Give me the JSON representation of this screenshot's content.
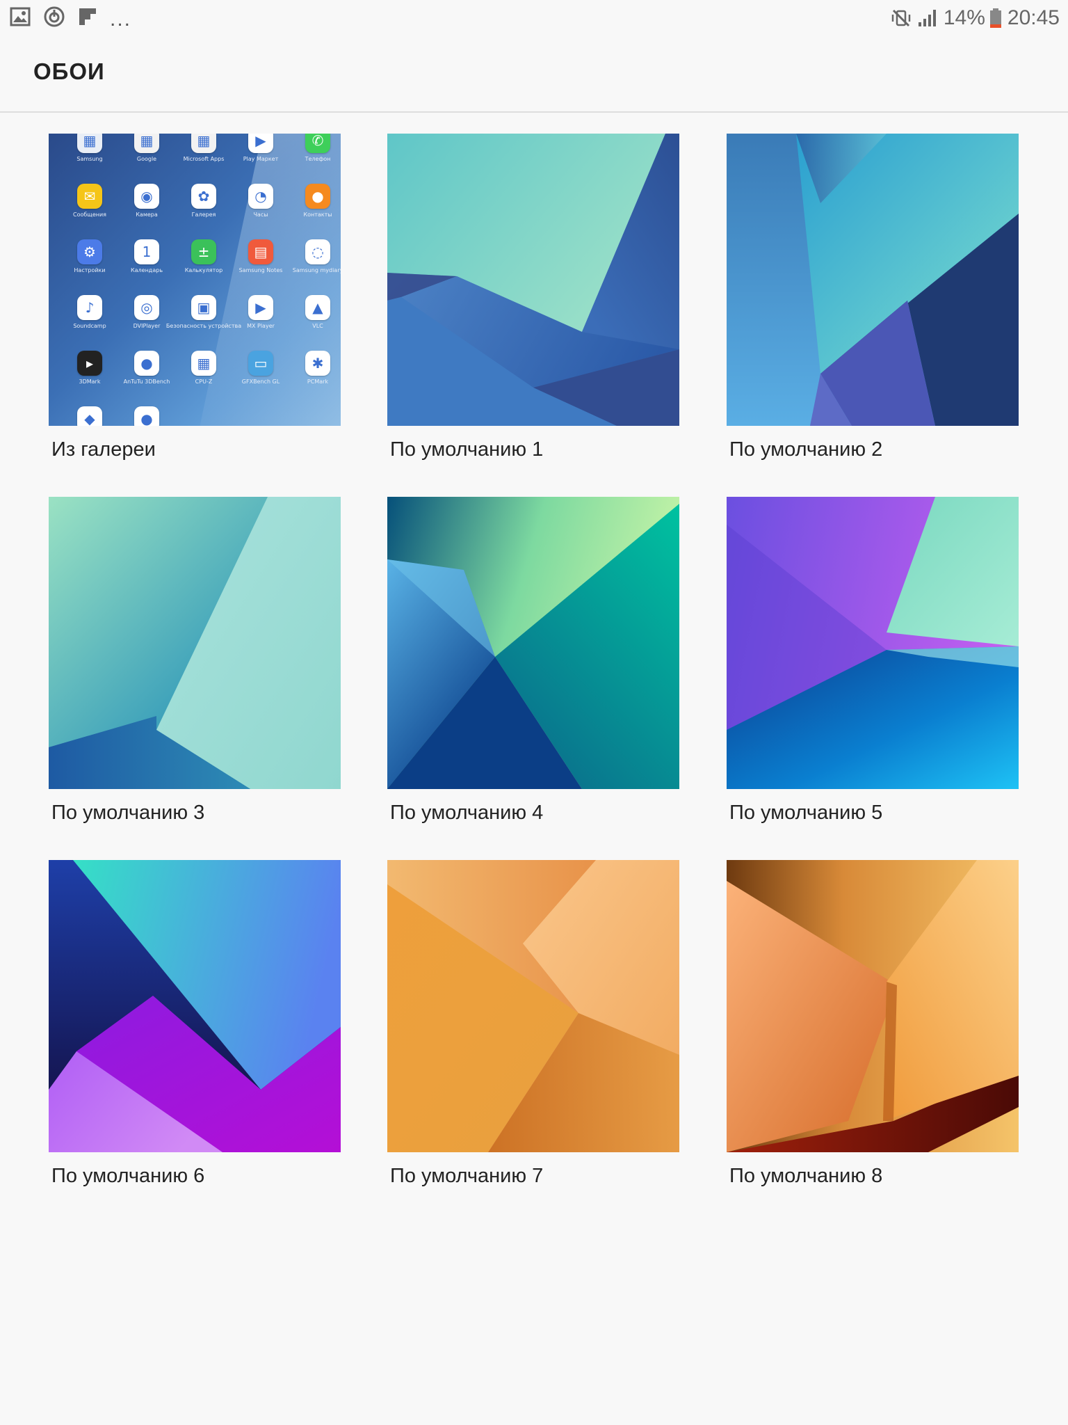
{
  "status_bar": {
    "battery_percent": "14%",
    "time": "20:45",
    "notification_icons": [
      "image-icon",
      "power-icon",
      "flipboard-icon"
    ],
    "overflow": "...",
    "status_icons": [
      "vibrate-mute-icon",
      "signal-icon",
      "battery-icon"
    ]
  },
  "header": {
    "title": "ОБОИ"
  },
  "tiles": [
    {
      "label": "Из галереи",
      "kind": "gallery"
    },
    {
      "label": "По умолчанию 1",
      "kind": "wallpaper"
    },
    {
      "label": "По умолчанию 2",
      "kind": "wallpaper"
    },
    {
      "label": "По умолчанию 3",
      "kind": "wallpaper"
    },
    {
      "label": "По умолчанию 4",
      "kind": "wallpaper"
    },
    {
      "label": "По умолчанию 5",
      "kind": "wallpaper"
    },
    {
      "label": "По умолчанию 6",
      "kind": "wallpaper"
    },
    {
      "label": "По умолчанию 7",
      "kind": "wallpaper"
    },
    {
      "label": "По умолчанию 8",
      "kind": "wallpaper"
    }
  ],
  "gallery_preview_apps": [
    {
      "name": "Samsung",
      "color": "#e9eef6",
      "icon": "folder-icon"
    },
    {
      "name": "Google",
      "color": "#f2f2f2",
      "icon": "folder-icon"
    },
    {
      "name": "Microsoft Apps",
      "color": "#f2f2f2",
      "icon": "folder-icon"
    },
    {
      "name": "Play Маркет",
      "color": "#ffffff",
      "icon": "play-store-icon"
    },
    {
      "name": "Телефон",
      "color": "#3ecf5a",
      "icon": "phone-icon"
    },
    {
      "name": "Сообщения",
      "color": "#f5c518",
      "icon": "messages-icon"
    },
    {
      "name": "Камера",
      "color": "#ffffff",
      "icon": "camera-icon"
    },
    {
      "name": "Галерея",
      "color": "#ffffff",
      "icon": "gallery-icon"
    },
    {
      "name": "Часы",
      "color": "#ffffff",
      "icon": "clock-icon"
    },
    {
      "name": "Контакты",
      "color": "#f58a1f",
      "icon": "contacts-icon"
    },
    {
      "name": "Настройки",
      "color": "#4c7be8",
      "icon": "settings-icon"
    },
    {
      "name": "Календарь",
      "color": "#ffffff",
      "icon": "calendar-icon"
    },
    {
      "name": "Калькулятор",
      "color": "#3bc15a",
      "icon": "calculator-icon"
    },
    {
      "name": "Samsung Notes",
      "color": "#f05a3c",
      "icon": "notes-icon"
    },
    {
      "name": "Samsung mydiary",
      "color": "#ffffff",
      "icon": "mydiary-icon"
    },
    {
      "name": "Soundcamp",
      "color": "#ffffff",
      "icon": "soundcamp-icon"
    },
    {
      "name": "DVIPlayer",
      "color": "#ffffff",
      "icon": "video-player-icon"
    },
    {
      "name": "Безопасность устройства",
      "color": "#ffffff",
      "icon": "lock-icon"
    },
    {
      "name": "MX Player",
      "color": "#ffffff",
      "icon": "mx-player-icon"
    },
    {
      "name": "VLC",
      "color": "#ffffff",
      "icon": "vlc-icon"
    },
    {
      "name": "3DMark",
      "color": "#222222",
      "icon": "3dmark-icon"
    },
    {
      "name": "AnTuTu 3DBench",
      "color": "#ffffff",
      "icon": "antutu-icon"
    },
    {
      "name": "CPU-Z",
      "color": "#ffffff",
      "icon": "cpu-z-icon"
    },
    {
      "name": "GFXBench GL",
      "color": "#4aa3e0",
      "icon": "gfxbench-icon"
    },
    {
      "name": "PCMark",
      "color": "#ffffff",
      "icon": "pcmark-icon"
    },
    {
      "name": "",
      "color": "#ffffff",
      "icon": "dropbox-icon"
    },
    {
      "name": "",
      "color": "#ffffff",
      "icon": "antutu-icon"
    }
  ],
  "colors": {
    "background": "#f8f8f8",
    "divider": "#dedede",
    "title_text": "#222222"
  }
}
